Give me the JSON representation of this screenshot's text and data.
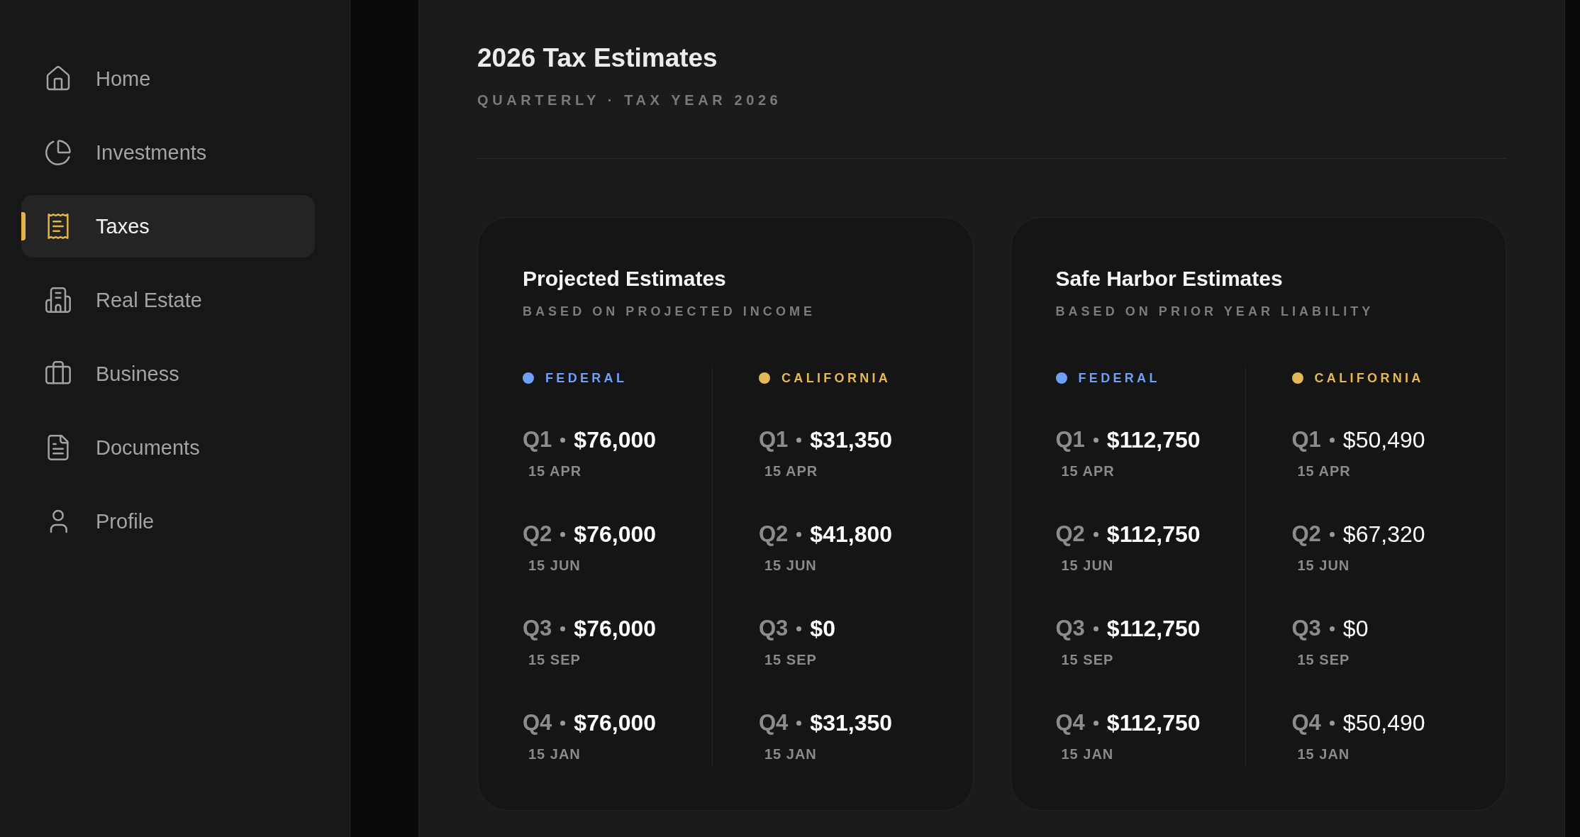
{
  "sidebar": {
    "items": [
      {
        "label": "Home",
        "selected": false
      },
      {
        "label": "Investments",
        "selected": false
      },
      {
        "label": "Taxes",
        "selected": true
      },
      {
        "label": "Real Estate",
        "selected": false
      },
      {
        "label": "Business",
        "selected": false
      },
      {
        "label": "Documents",
        "selected": false
      },
      {
        "label": "Profile",
        "selected": false
      }
    ]
  },
  "header": {
    "title": "2026 Tax Estimates",
    "subtitle": "QUARTERLY · TAX YEAR 2026"
  },
  "cards": [
    {
      "title": "Projected Estimates",
      "subtitle": "BASED ON PROJECTED INCOME",
      "columns": [
        {
          "label": "FEDERAL",
          "color": "#6ea0f5",
          "values_bold": true,
          "rows": [
            {
              "quarter": "Q1",
              "amount": "$76,000",
              "due": "15 APR"
            },
            {
              "quarter": "Q2",
              "amount": "$76,000",
              "due": "15 JUN"
            },
            {
              "quarter": "Q3",
              "amount": "$76,000",
              "due": "15 SEP"
            },
            {
              "quarter": "Q4",
              "amount": "$76,000",
              "due": "15 JAN"
            }
          ]
        },
        {
          "label": "CALIFORNIA",
          "color": "#e2b953",
          "values_bold": true,
          "rows": [
            {
              "quarter": "Q1",
              "amount": "$31,350",
              "due": "15 APR"
            },
            {
              "quarter": "Q2",
              "amount": "$41,800",
              "due": "15 JUN"
            },
            {
              "quarter": "Q3",
              "amount": "$0",
              "due": "15 SEP"
            },
            {
              "quarter": "Q4",
              "amount": "$31,350",
              "due": "15 JAN"
            }
          ]
        }
      ]
    },
    {
      "title": "Safe Harbor Estimates",
      "subtitle": "BASED ON PRIOR YEAR LIABILITY",
      "columns": [
        {
          "label": "FEDERAL",
          "color": "#6ea0f5",
          "values_bold": true,
          "rows": [
            {
              "quarter": "Q1",
              "amount": "$112,750",
              "due": "15 APR"
            },
            {
              "quarter": "Q2",
              "amount": "$112,750",
              "due": "15 JUN"
            },
            {
              "quarter": "Q3",
              "amount": "$112,750",
              "due": "15 SEP"
            },
            {
              "quarter": "Q4",
              "amount": "$112,750",
              "due": "15 JAN"
            }
          ]
        },
        {
          "label": "CALIFORNIA",
          "color": "#e2b953",
          "values_bold": false,
          "rows": [
            {
              "quarter": "Q1",
              "amount": "$50,490",
              "due": "15 APR"
            },
            {
              "quarter": "Q2",
              "amount": "$67,320",
              "due": "15 JUN"
            },
            {
              "quarter": "Q3",
              "amount": "$0",
              "due": "15 SEP"
            },
            {
              "quarter": "Q4",
              "amount": "$50,490",
              "due": "15 JAN"
            }
          ]
        }
      ]
    }
  ]
}
